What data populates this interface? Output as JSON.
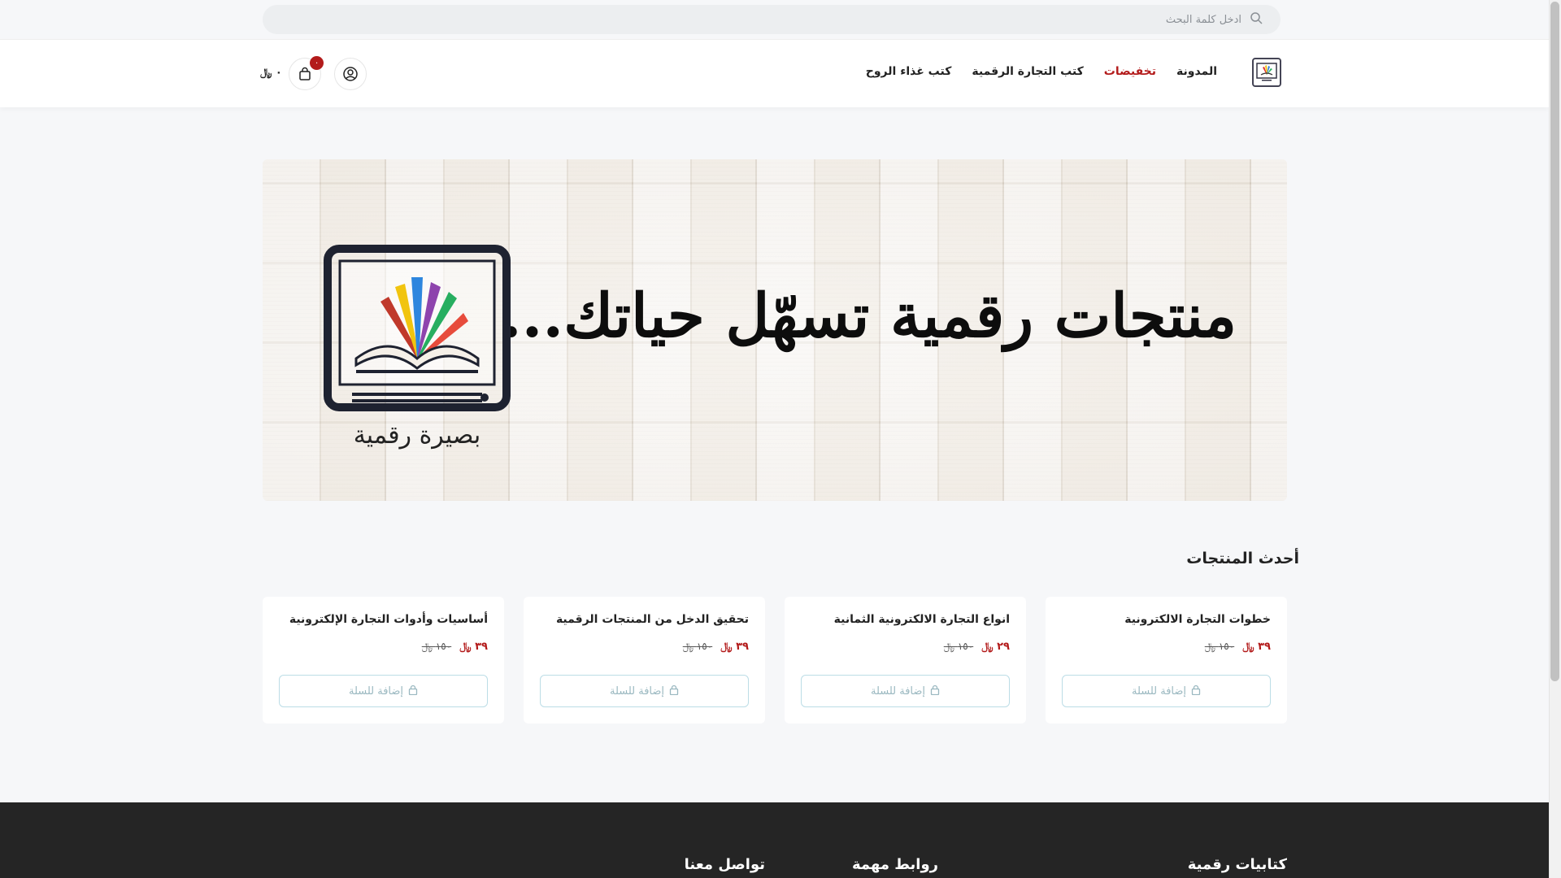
{
  "search": {
    "placeholder": "ادخل كلمة البحث"
  },
  "nav": {
    "items": [
      {
        "label": "المدونة"
      },
      {
        "label": "تخفيضات"
      },
      {
        "label": "كتب التجارة الرقمية"
      },
      {
        "label": "كتب غذاء الروح"
      }
    ]
  },
  "cart": {
    "count": "٠",
    "total": "٠ ﷼"
  },
  "hero": {
    "title": "منتجات رقمية تسهّل حياتك...",
    "logo_caption": "بصيرة رقمية"
  },
  "section": {
    "title": "أحدث المنتجات"
  },
  "products": [
    {
      "title": "أساسيات وأدوات التجارة الإلكترونية",
      "price": "٣٩ ﷼",
      "old_price": "١٥٠ ﷼",
      "button": "إضافة للسلة"
    },
    {
      "title": "تحقيق الدخل من المنتجات الرقمية",
      "price": "٣٩ ﷼",
      "old_price": "١٥٠ ﷼",
      "button": "إضافة للسلة"
    },
    {
      "title": "انواع التجارة الالكترونية الثمانية",
      "price": "٢٩ ﷼",
      "old_price": "١٥٠ ﷼",
      "button": "إضافة للسلة"
    },
    {
      "title": "خطوات التجارة الالكترونية",
      "price": "٣٩ ﷼",
      "old_price": "١٥٠ ﷼",
      "button": "إضافة للسلة"
    }
  ],
  "footer": {
    "col1": "كتابيات رقمية",
    "col2": "روابط مهمة",
    "col3": "تواصل معنا"
  },
  "colors": {
    "accent": "#b31b1b",
    "footer_bg": "#252525",
    "button_border": "#bcdde6"
  }
}
